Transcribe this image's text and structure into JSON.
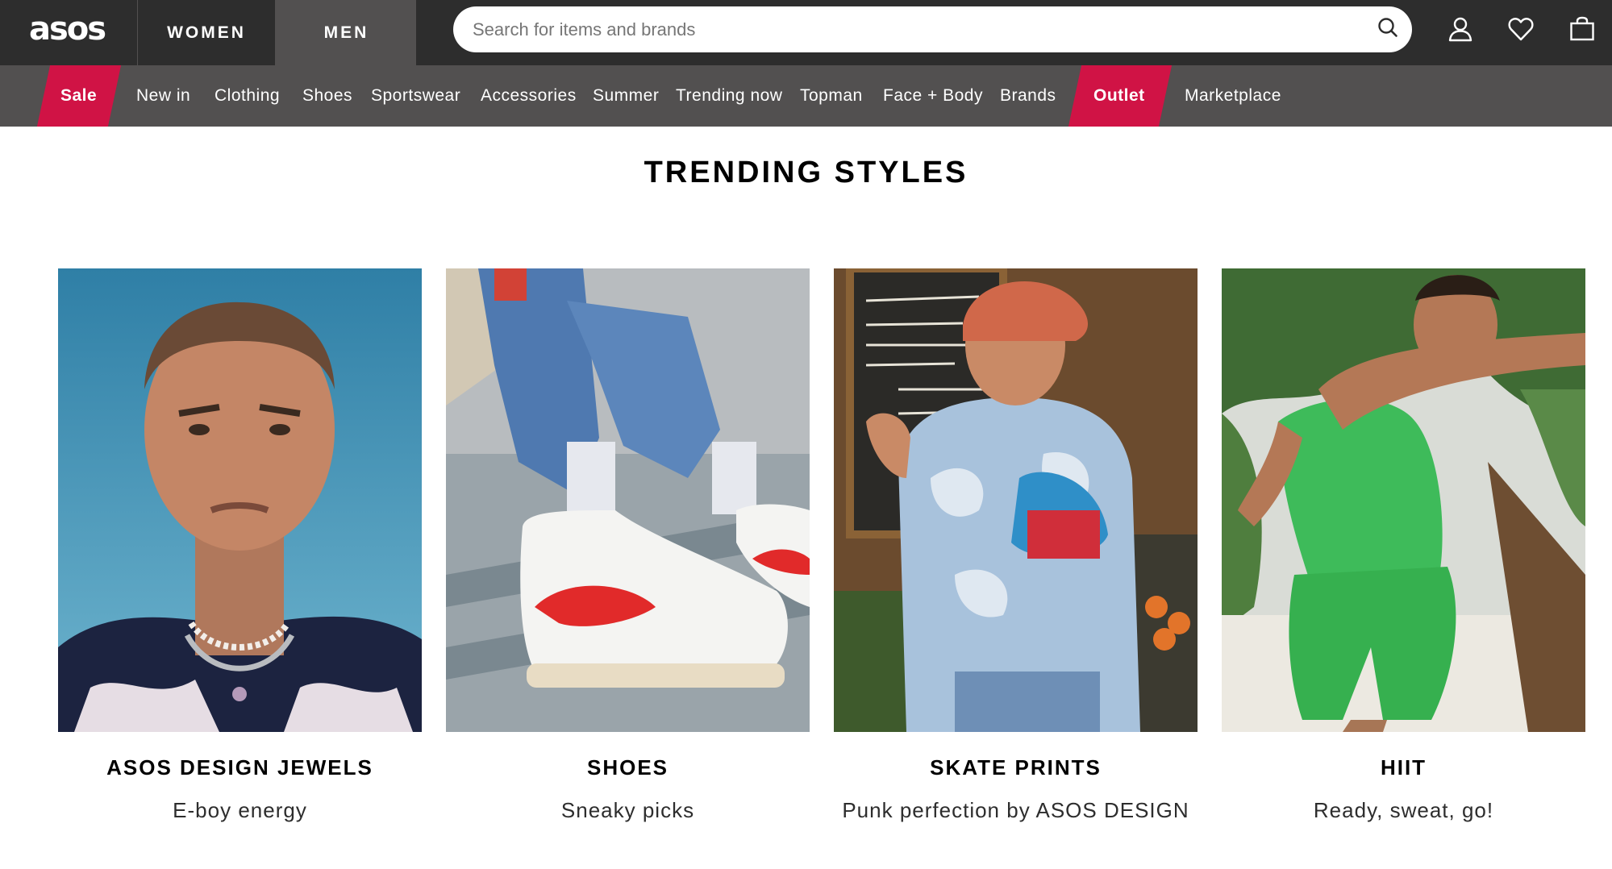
{
  "header": {
    "logo": "asos",
    "gender_tabs": [
      {
        "label": "WOMEN",
        "active": false
      },
      {
        "label": "MEN",
        "active": true
      }
    ],
    "search": {
      "placeholder": "Search for items and brands",
      "value": ""
    },
    "icons": [
      "search-icon",
      "account-icon",
      "heart-icon",
      "bag-icon"
    ]
  },
  "nav": {
    "items": [
      {
        "label": "Sale",
        "highlight": true
      },
      {
        "label": "New in"
      },
      {
        "label": "Clothing"
      },
      {
        "label": "Shoes"
      },
      {
        "label": "Sportswear"
      },
      {
        "label": "Accessories"
      },
      {
        "label": "Summer"
      },
      {
        "label": "Trending now"
      },
      {
        "label": "Topman"
      },
      {
        "label": "Face + Body"
      },
      {
        "label": "Brands"
      },
      {
        "label": "Outlet",
        "highlight": true
      },
      {
        "label": "Marketplace"
      }
    ]
  },
  "main": {
    "title": "TRENDING STYLES",
    "cards": [
      {
        "title": "ASOS DESIGN JEWELS",
        "subtitle": "E-boy energy"
      },
      {
        "title": "SHOES",
        "subtitle": "Sneaky picks"
      },
      {
        "title": "SKATE PRINTS",
        "subtitle": "Punk perfection by ASOS DESIGN"
      },
      {
        "title": "HIIT",
        "subtitle": "Ready, sweat, go!"
      }
    ]
  },
  "colors": {
    "header_bg": "#2d2d2d",
    "nav_bg": "#525050",
    "sale_accent": "#d01345",
    "text": "#2d2d2d"
  }
}
